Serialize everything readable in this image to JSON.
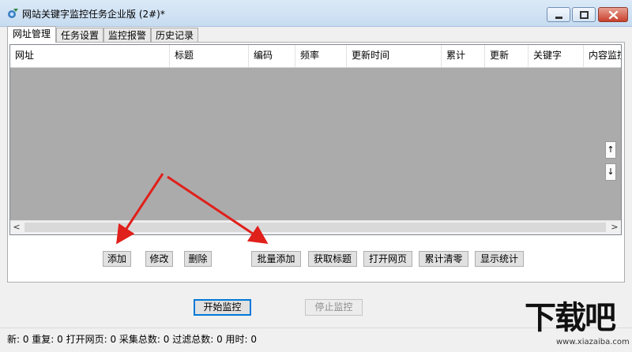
{
  "window": {
    "title": "网站关键字监控任务企业版  (2#)*"
  },
  "tabs": [
    {
      "label": "网址管理",
      "active": true
    },
    {
      "label": "任务设置",
      "active": false
    },
    {
      "label": "监控报警",
      "active": false
    },
    {
      "label": "历史记录",
      "active": false
    }
  ],
  "grid": {
    "columns": [
      "网址",
      "标题",
      "编码",
      "频率",
      "更新时间",
      "累计",
      "更新",
      "关键字",
      "内容监控"
    ],
    "rows": []
  },
  "side_buttons": {
    "up": "↑",
    "down": "↓"
  },
  "action_buttons": {
    "add": "添加",
    "edit": "修改",
    "delete": "删除",
    "batch_add": "批量添加",
    "fetch_title": "获取标题",
    "open_page": "打开网页",
    "reset_total": "累计清零",
    "show_stats": "显示统计"
  },
  "control_buttons": {
    "start": "开始监控",
    "stop": "停止监控"
  },
  "status": {
    "text": "新:  0  重复:  0  打开网页:  0  采集总数:  0  过滤总数:  0  用时:  0"
  },
  "watermark": {
    "text": "下载吧",
    "url": "www.xiazaiba.com"
  },
  "colors": {
    "grid_background": "#ababab",
    "annotation_arrow": "#e0201b",
    "primary_border": "#0078d7"
  }
}
